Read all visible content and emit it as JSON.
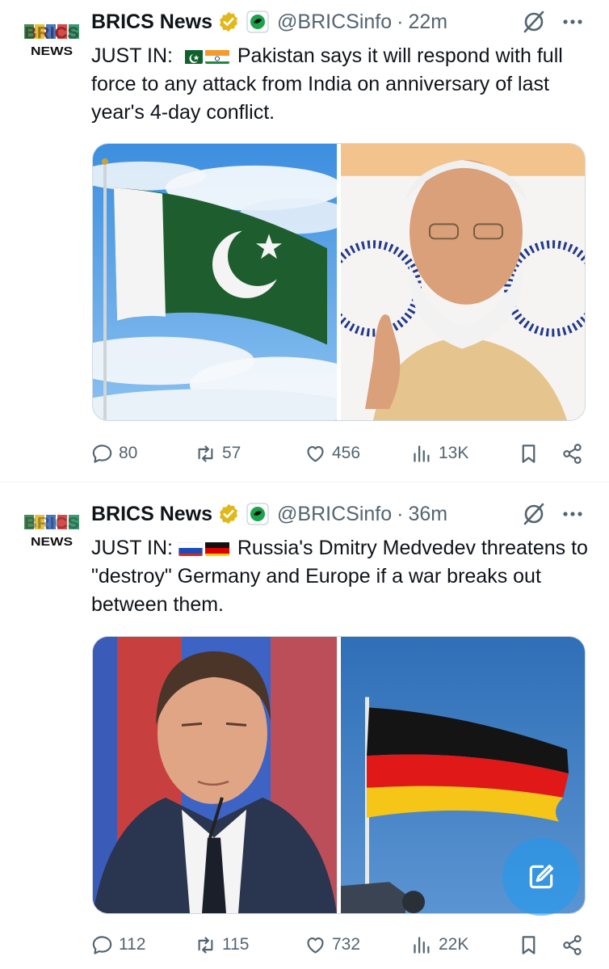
{
  "colors": {
    "text_primary": "#0f1419",
    "text_secondary": "#536471",
    "verified_gold": "#e2b719",
    "accent_blue": "#1d9bf0"
  },
  "tweets": [
    {
      "author_name": "BRICS News",
      "avatar_text": "BRICS NEWS",
      "handle": "@BRICSinfo",
      "separator": "·",
      "time": "22m",
      "lead": "JUST IN:",
      "flags": [
        "pakistan-flag",
        "india-flag"
      ],
      "body": "Pakistan says it will respond with full force to any attack from India on anniversary of last year's 4-day conflict.",
      "images": [
        "pakistan-flag-photo",
        "narendra-modi-photo"
      ],
      "replies": "80",
      "reposts": "57",
      "likes": "456",
      "views": "13K"
    },
    {
      "author_name": "BRICS News",
      "avatar_text": "BRICS NEWS",
      "handle": "@BRICSinfo",
      "separator": "·",
      "time": "36m",
      "lead": "JUST IN:",
      "flags": [
        "russia-flag",
        "germany-flag"
      ],
      "body": "Russia's Dmitry Medvedev threatens to \"destroy\" Germany and Europe if a war breaks out between them.",
      "images": [
        "dmitry-medvedev-photo",
        "germany-flag-photo"
      ],
      "replies": "112",
      "reposts": "115",
      "likes": "732",
      "views": "22K"
    }
  ],
  "icons": {
    "reply": "reply-icon",
    "repost": "repost-icon",
    "like": "like-icon",
    "views": "views-icon",
    "bookmark": "bookmark-icon",
    "share": "share-icon",
    "grok": "grok-icon",
    "more": "more-icon",
    "compose": "compose-icon"
  }
}
